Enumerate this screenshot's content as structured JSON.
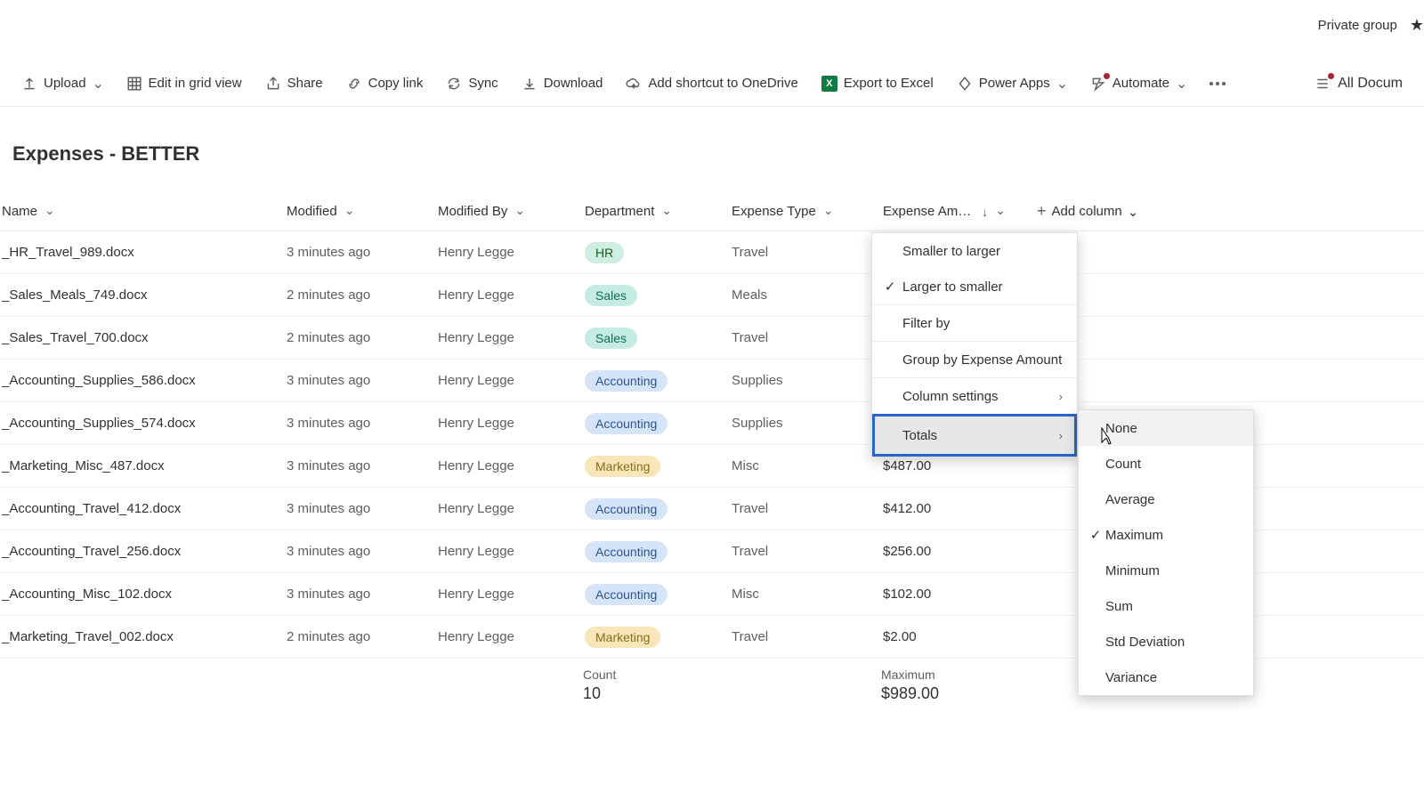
{
  "header": {
    "private_group": "Private group"
  },
  "toolbar": {
    "upload": "Upload",
    "edit_grid": "Edit in grid view",
    "share": "Share",
    "copy_link": "Copy link",
    "sync": "Sync",
    "download": "Download",
    "shortcut": "Add shortcut to OneDrive",
    "export_excel": "Export to Excel",
    "power_apps": "Power Apps",
    "automate": "Automate",
    "all_documents": "All Docum"
  },
  "title": "Expenses - BETTER",
  "columns": {
    "name": "Name",
    "modified": "Modified",
    "modified_by": "Modified By",
    "department": "Department",
    "expense_type": "Expense Type",
    "expense_amount": "Expense Am…",
    "add_column": "Add column"
  },
  "rows": [
    {
      "name": "_HR_Travel_989.docx",
      "modified": "3 minutes ago",
      "modified_by": "Henry Legge",
      "dept": "HR",
      "dept_class": "hr",
      "type": "Travel",
      "amount": ""
    },
    {
      "name": "_Sales_Meals_749.docx",
      "modified": "2 minutes ago",
      "modified_by": "Henry Legge",
      "dept": "Sales",
      "dept_class": "sales",
      "type": "Meals",
      "amount": ""
    },
    {
      "name": "_Sales_Travel_700.docx",
      "modified": "2 minutes ago",
      "modified_by": "Henry Legge",
      "dept": "Sales",
      "dept_class": "sales",
      "type": "Travel",
      "amount": ""
    },
    {
      "name": "_Accounting_Supplies_586.docx",
      "modified": "3 minutes ago",
      "modified_by": "Henry Legge",
      "dept": "Accounting",
      "dept_class": "accounting",
      "type": "Supplies",
      "amount": ""
    },
    {
      "name": "_Accounting_Supplies_574.docx",
      "modified": "3 minutes ago",
      "modified_by": "Henry Legge",
      "dept": "Accounting",
      "dept_class": "accounting",
      "type": "Supplies",
      "amount": ""
    },
    {
      "name": "_Marketing_Misc_487.docx",
      "modified": "3 minutes ago",
      "modified_by": "Henry Legge",
      "dept": "Marketing",
      "dept_class": "marketing",
      "type": "Misc",
      "amount": "$487.00"
    },
    {
      "name": "_Accounting_Travel_412.docx",
      "modified": "3 minutes ago",
      "modified_by": "Henry Legge",
      "dept": "Accounting",
      "dept_class": "accounting",
      "type": "Travel",
      "amount": "$412.00"
    },
    {
      "name": "_Accounting_Travel_256.docx",
      "modified": "3 minutes ago",
      "modified_by": "Henry Legge",
      "dept": "Accounting",
      "dept_class": "accounting",
      "type": "Travel",
      "amount": "$256.00"
    },
    {
      "name": "_Accounting_Misc_102.docx",
      "modified": "3 minutes ago",
      "modified_by": "Henry Legge",
      "dept": "Accounting",
      "dept_class": "accounting",
      "type": "Misc",
      "amount": "$102.00"
    },
    {
      "name": "_Marketing_Travel_002.docx",
      "modified": "2 minutes ago",
      "modified_by": "Henry Legge",
      "dept": "Marketing",
      "dept_class": "marketing",
      "type": "Travel",
      "amount": "$2.00"
    }
  ],
  "footer": {
    "count_label": "Count",
    "count_value": "10",
    "max_label": "Maximum",
    "max_value": "$989.00"
  },
  "context_menu": {
    "smaller_larger": "Smaller to larger",
    "larger_smaller": "Larger to smaller",
    "filter_by": "Filter by",
    "group_by": "Group by Expense Amount",
    "column_settings": "Column settings",
    "totals": "Totals"
  },
  "totals_submenu": {
    "none": "None",
    "count": "Count",
    "average": "Average",
    "maximum": "Maximum",
    "minimum": "Minimum",
    "sum": "Sum",
    "std_dev": "Std Deviation",
    "variance": "Variance"
  }
}
